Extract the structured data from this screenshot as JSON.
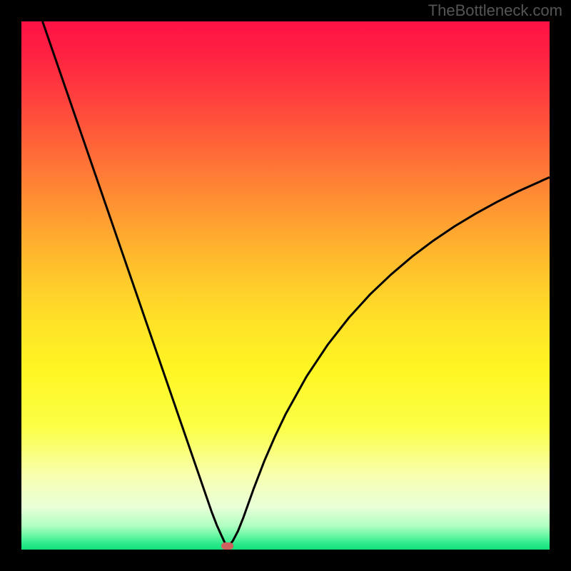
{
  "watermark": "TheBottleneck.com",
  "chart_data": {
    "type": "line",
    "title": "",
    "xlabel": "",
    "ylabel": "",
    "xlim": [
      0,
      100
    ],
    "ylim": [
      0,
      100
    ],
    "background_gradient": {
      "stops": [
        {
          "pos": 0.0,
          "color": "#ff1146"
        },
        {
          "pos": 0.06,
          "color": "#ff2142"
        },
        {
          "pos": 0.15,
          "color": "#ff423d"
        },
        {
          "pos": 0.25,
          "color": "#ff6b38"
        },
        {
          "pos": 0.35,
          "color": "#ff9432"
        },
        {
          "pos": 0.45,
          "color": "#ffbb2d"
        },
        {
          "pos": 0.55,
          "color": "#ffdd28"
        },
        {
          "pos": 0.66,
          "color": "#fff623"
        },
        {
          "pos": 0.77,
          "color": "#fbff47"
        },
        {
          "pos": 0.86,
          "color": "#f8ffb0"
        },
        {
          "pos": 0.92,
          "color": "#e8ffd8"
        },
        {
          "pos": 0.955,
          "color": "#b0ffc0"
        },
        {
          "pos": 0.975,
          "color": "#62f6a0"
        },
        {
          "pos": 0.99,
          "color": "#28e889"
        },
        {
          "pos": 1.0,
          "color": "#13e07e"
        }
      ]
    },
    "series": [
      {
        "name": "bottleneck-curve",
        "color": "#000000",
        "stroke_width": 3,
        "x": [
          4,
          6,
          8,
          10,
          12,
          14,
          16,
          18,
          20,
          22,
          24,
          26,
          28,
          30,
          32,
          34,
          35,
          36,
          37,
          38,
          38.6,
          39.4,
          40,
          41,
          42,
          43,
          44,
          46,
          48,
          50,
          54,
          58,
          62,
          66,
          70,
          74,
          78,
          82,
          86,
          90,
          94,
          98,
          100
        ],
        "y": [
          100,
          94.2,
          88.4,
          82.6,
          76.8,
          71,
          65.2,
          59.4,
          53.6,
          47.8,
          42,
          36.2,
          30.4,
          24.6,
          18.8,
          13,
          10.1,
          7.2,
          4.6,
          2.4,
          1.1,
          0.9,
          1.6,
          3.5,
          6.0,
          8.8,
          11.6,
          16.8,
          21.4,
          25.6,
          32.8,
          38.8,
          43.9,
          48.3,
          52.1,
          55.5,
          58.5,
          61.2,
          63.6,
          65.8,
          67.8,
          69.6,
          70.5
        ]
      }
    ],
    "marker": {
      "name": "optimal-point",
      "x": 39,
      "y": 0.7,
      "width_pct": 2.4,
      "height_pct": 1.4,
      "color": "#cf615f"
    }
  }
}
